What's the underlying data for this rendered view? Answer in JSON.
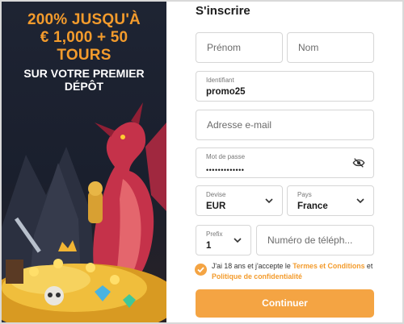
{
  "promo": {
    "headline_line1": "200% JUSQU'À",
    "headline_line2": "€ 1,000 + 50",
    "headline_line3": "TOURS",
    "sub_line1": "SUR VOTRE PREMIER",
    "sub_line2": "DÉPÔT"
  },
  "form": {
    "title": "S'inscrire",
    "first_name_placeholder": "Prénom",
    "last_name_placeholder": "Nom",
    "username_label": "Identifiant",
    "username_value": "promo25",
    "email_placeholder": "Adresse e-mail",
    "password_label": "Mot de passe",
    "password_value": "•••••••••••••",
    "currency_label": "Devise",
    "currency_value": "EUR",
    "country_label": "Pays",
    "country_value": "France",
    "prefix_label": "Prefix",
    "prefix_value": "1",
    "phone_placeholder": "Numéro de téléph...",
    "terms_prefix": "J'ai 18 ans et j'accepte le ",
    "terms_link": "Termes et Conditions",
    "terms_and": " et ",
    "privacy_link": "Politique de confidentialité",
    "submit_label": "Continuer"
  },
  "colors": {
    "accent": "#f4a443",
    "promo_bg": "#1e2433",
    "headline": "#f39b2c"
  },
  "icons": {
    "eye": "eye-off-icon",
    "chevron": "chevron-down-icon",
    "check": "check-icon"
  }
}
